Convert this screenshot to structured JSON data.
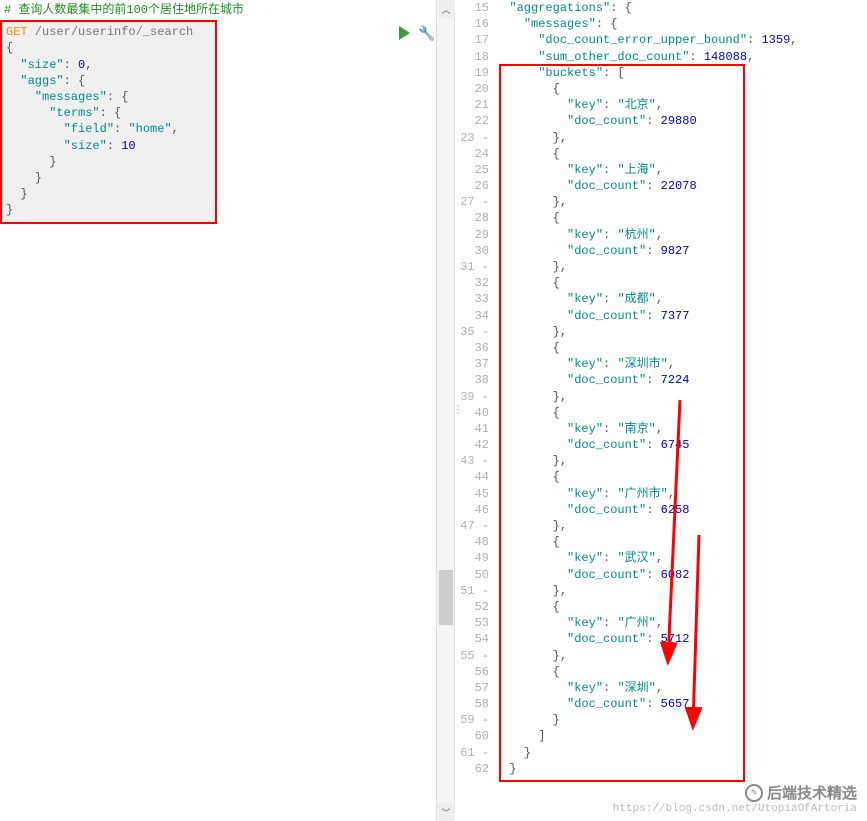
{
  "left": {
    "comment": "# 查询人数最集中的前100个居住地所在城市",
    "http_method": "GET",
    "path": " /user/userinfo/_search",
    "query": {
      "l1": "{",
      "l2": "  \"size\": 0,",
      "l3": "  \"aggs\": {",
      "l4": "    \"messages\": {",
      "l5": "      \"terms\": {",
      "l6": "        \"field\": \"home\",",
      "l7": "        \"size\": 10",
      "l8": "      }",
      "l9": "    }",
      "l10": "  }",
      "l11": "}"
    }
  },
  "gutter": {
    "start": 15,
    "lines": [
      "15",
      "16",
      "17",
      "18",
      "19",
      "20",
      "21",
      "22",
      "23",
      "24",
      "25",
      "26",
      "27",
      "28",
      "29",
      "30",
      "31",
      "32",
      "33",
      "34",
      "35",
      "36",
      "37",
      "38",
      "39",
      "40",
      "41",
      "42",
      "43",
      "44",
      "45",
      "46",
      "47",
      "48",
      "49",
      "50",
      "51",
      "52",
      "53",
      "54",
      "55",
      "56",
      "57",
      "58",
      "59",
      "60",
      "61",
      "62"
    ]
  },
  "response": {
    "aggregations_label": "\"aggregations\"",
    "messages_label": "\"messages\"",
    "err_key": "\"doc_count_error_upper_bound\"",
    "err_val": "1359",
    "sum_key": "\"sum_other_doc_count\"",
    "sum_val": "148088",
    "buckets_label": "\"buckets\"",
    "key_label": "\"key\"",
    "count_label": "\"doc_count\"",
    "buckets": [
      {
        "key": "\"北京\"",
        "count": "29880"
      },
      {
        "key": "\"上海\"",
        "count": "22078"
      },
      {
        "key": "\"杭州\"",
        "count": "9827"
      },
      {
        "key": "\"成都\"",
        "count": "7377"
      },
      {
        "key": "\"深圳市\"",
        "count": "7224"
      },
      {
        "key": "\"南京\"",
        "count": "6745"
      },
      {
        "key": "\"广州市\"",
        "count": "6258"
      },
      {
        "key": "\"武汉\"",
        "count": "6082"
      },
      {
        "key": "\"广州\"",
        "count": "5712"
      },
      {
        "key": "\"深圳\"",
        "count": "5657"
      }
    ]
  },
  "watermark": {
    "title": "后端技术精选",
    "sub": "https://blog.csdn.net/UtopiaOfArtoria"
  }
}
